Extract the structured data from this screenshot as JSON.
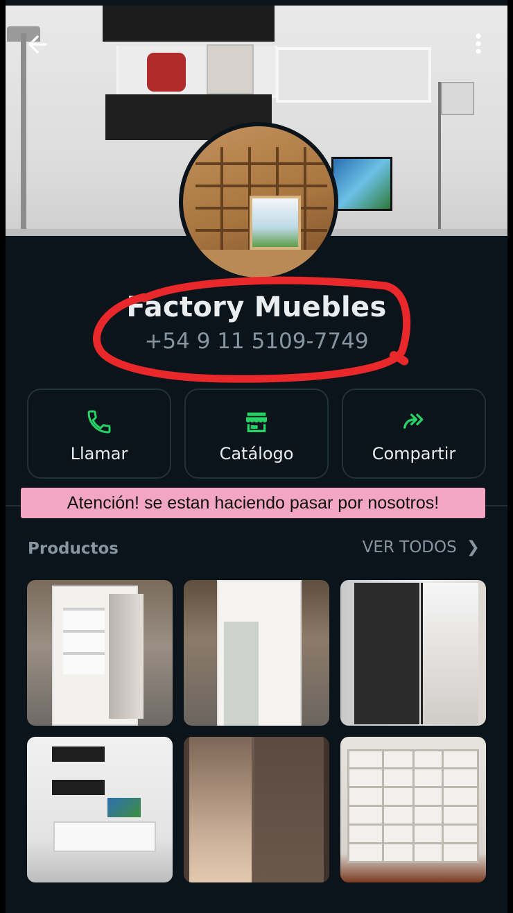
{
  "profile": {
    "name": "Factory Muebles",
    "phone": "+54 9 11 5109-7749"
  },
  "actions": [
    {
      "label": "Llamar",
      "icon": "phone-icon"
    },
    {
      "label": "Catálogo",
      "icon": "storefront-icon"
    },
    {
      "label": "Compartir",
      "icon": "share-forward-icon"
    }
  ],
  "warning": "Atención! se estan haciendo pasar por nosotros!",
  "products": {
    "title": "Productos",
    "see_all": "VER TODOS",
    "items": [
      {
        "icon": "product-image"
      },
      {
        "icon": "product-image"
      },
      {
        "icon": "product-image"
      },
      {
        "icon": "product-image"
      },
      {
        "icon": "product-image"
      },
      {
        "icon": "product-image"
      }
    ]
  },
  "colors": {
    "background": "#0b141a",
    "accent_green": "#25d366",
    "annotation_red": "#e8282a",
    "warning_bg": "#f2a6c2"
  }
}
